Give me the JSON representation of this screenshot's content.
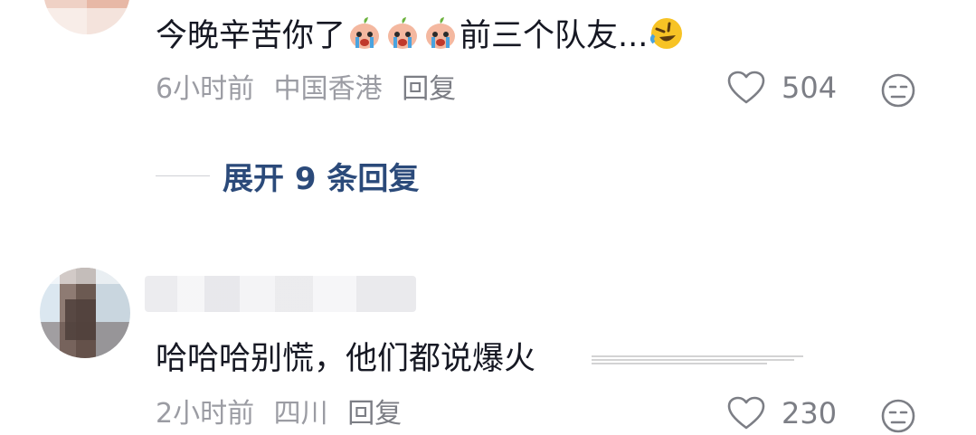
{
  "comments": [
    {
      "text_main": "今晚辛苦你了",
      "text_tail": "前三个队友...",
      "time": "6小时前",
      "location": "中国香港",
      "reply_label": "回复",
      "like_count": "504"
    },
    {
      "text_main": "哈哈哈别慌，他们都说爆火",
      "time": "2小时前",
      "location": "四川",
      "reply_label": "回复",
      "like_count": "230"
    }
  ],
  "expand_replies": "展开 9 条回复",
  "icons": {
    "like": "heart-outline-icon",
    "dislike": "neutral-face-icon",
    "emoji_cry": "crying-peach-emoji",
    "emoji_laugh": "rofl-emoji"
  },
  "colors": {
    "text": "#161823",
    "meta": "#9b9ca3",
    "expand": "#2b4a7a"
  }
}
